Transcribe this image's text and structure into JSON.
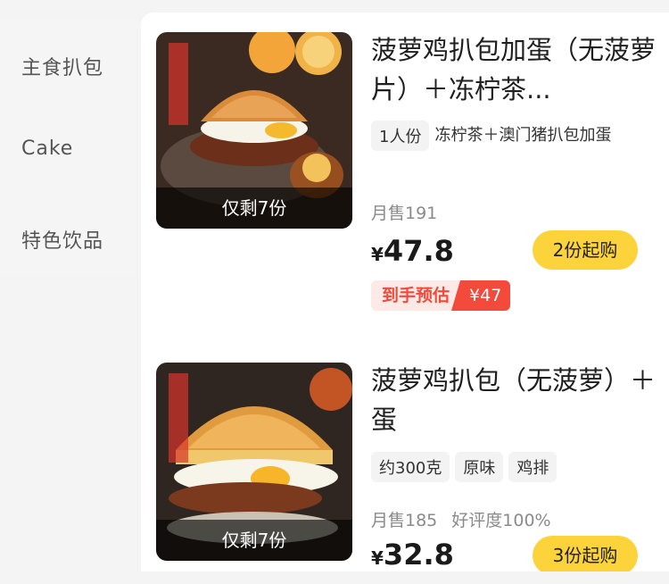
{
  "sidebar": {
    "items": [
      {
        "label": "主食扒包"
      },
      {
        "label": "Cake"
      },
      {
        "label": "特色饮品"
      }
    ]
  },
  "products": [
    {
      "title": "菠萝鸡扒包加蛋（无菠萝片）＋冻柠茶...",
      "stock_text": "仅剩7份",
      "tag": "1人份",
      "description": "冻柠茶＋澳门猪扒包加蛋",
      "sales": "月售191",
      "currency": "¥",
      "price": "47.8",
      "min_order": "2份起购",
      "estimate_label": "到手预估",
      "estimate_price": "¥47"
    },
    {
      "title": "菠萝鸡扒包（无菠萝）＋蛋",
      "stock_text": "仅剩7份",
      "tags": [
        "约300克",
        "原味",
        "鸡排"
      ],
      "sales": "月售185",
      "rating": "好评度100%",
      "currency": "¥",
      "price": "32.8",
      "min_order": "3份起购"
    }
  ],
  "colors": {
    "accent_yellow": "#fdd33b",
    "estimate_red": "#f34a3c"
  }
}
